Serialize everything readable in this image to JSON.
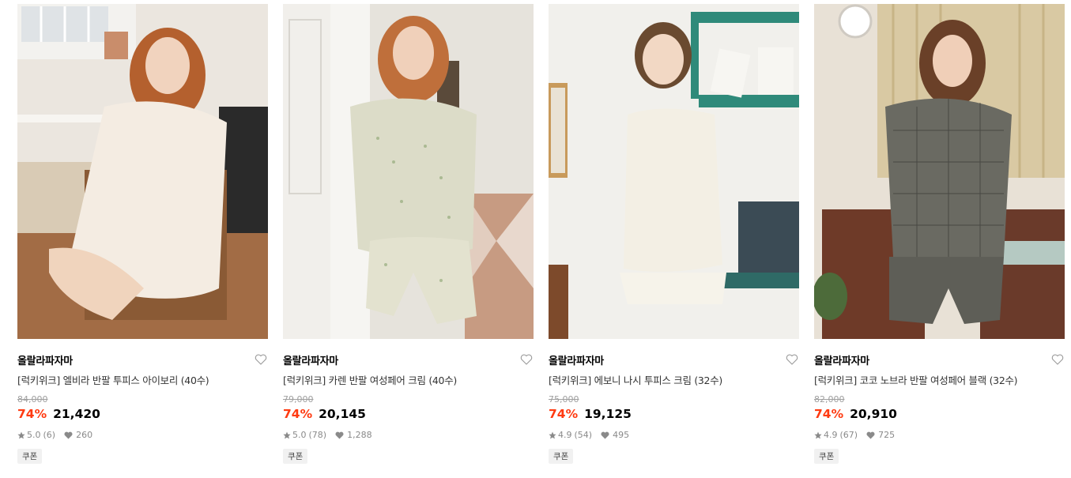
{
  "colors": {
    "discount": "#ff3b12",
    "muted": "#8a8a8a",
    "strike": "#a0a0a0"
  },
  "products": [
    {
      "brand": "올랄라파자마",
      "title": "[럭키위크] 엘비라 반팔 투피스 아이보리 (40수)",
      "original_price": "84,000",
      "discount": "74%",
      "price": "21,420",
      "rating": "5.0",
      "reviews": "(6)",
      "likes": "260",
      "coupon": "쿠폰"
    },
    {
      "brand": "올랄라파자마",
      "title": "[럭키위크] 카렌 반팔 여성페어 크림 (40수)",
      "original_price": "79,000",
      "discount": "74%",
      "price": "20,145",
      "rating": "5.0",
      "reviews": "(78)",
      "likes": "1,288",
      "coupon": "쿠폰"
    },
    {
      "brand": "올랄라파자마",
      "title": "[럭키위크] 에보니 나시 투피스 크림 (32수)",
      "original_price": "75,000",
      "discount": "74%",
      "price": "19,125",
      "rating": "4.9",
      "reviews": "(54)",
      "likes": "495",
      "coupon": "쿠폰"
    },
    {
      "brand": "올랄라파자마",
      "title": "[럭키위크] 코코 노브라 반팔 여성페어 블랙 (32수)",
      "original_price": "82,000",
      "discount": "74%",
      "price": "20,910",
      "rating": "4.9",
      "reviews": "(67)",
      "likes": "725",
      "coupon": "쿠폰"
    }
  ]
}
